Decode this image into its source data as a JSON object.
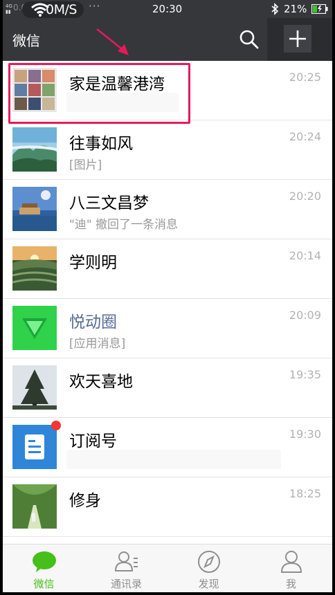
{
  "status_bar": {
    "network": "4G",
    "speed_ghost": "0.06K/s",
    "speed": "0M/S",
    "dots": "···",
    "time": "20:30",
    "battery": "21%"
  },
  "header": {
    "title": "微信",
    "search_icon": "search-icon",
    "add_icon": "plus-icon"
  },
  "chats": [
    {
      "name": "家是温馨港湾",
      "preview": "",
      "time": "20:25",
      "avatar": "group-grid",
      "highlighted": true
    },
    {
      "name": "往事如风",
      "preview": "[图片]",
      "time": "20:24",
      "avatar": "mountain-landscape"
    },
    {
      "name": "八三文昌梦",
      "preview": "\"迪\" 撤回了一条消息",
      "time": "20:20",
      "avatar": "pier-moon"
    },
    {
      "name": "学则明",
      "preview": "",
      "time": "20:14",
      "avatar": "sunset-terraces"
    },
    {
      "name": "悦动圈",
      "preview": "[应用消息]",
      "time": "20:09",
      "avatar": "green-v-logo",
      "service": true
    },
    {
      "name": "欢天喜地",
      "preview": "",
      "time": "19:35",
      "avatar": "tree-silhouette"
    },
    {
      "name": "订阅号",
      "preview": "",
      "time": "19:30",
      "avatar": "subscription-doc",
      "unread_dot": true
    },
    {
      "name": "修身",
      "preview": "",
      "time": "18:25",
      "avatar": "bamboo-path"
    }
  ],
  "tabs": [
    {
      "label": "微信",
      "icon": "chat-bubble-icon",
      "active": true
    },
    {
      "label": "通讯录",
      "icon": "contacts-icon"
    },
    {
      "label": "发现",
      "icon": "compass-icon"
    },
    {
      "label": "我",
      "icon": "person-icon"
    }
  ],
  "colors": {
    "header_bg": "#35373b",
    "accent_green": "#45c01a",
    "highlight": "#e8195a",
    "badge_red": "#f43530",
    "service_name": "#576b95"
  }
}
